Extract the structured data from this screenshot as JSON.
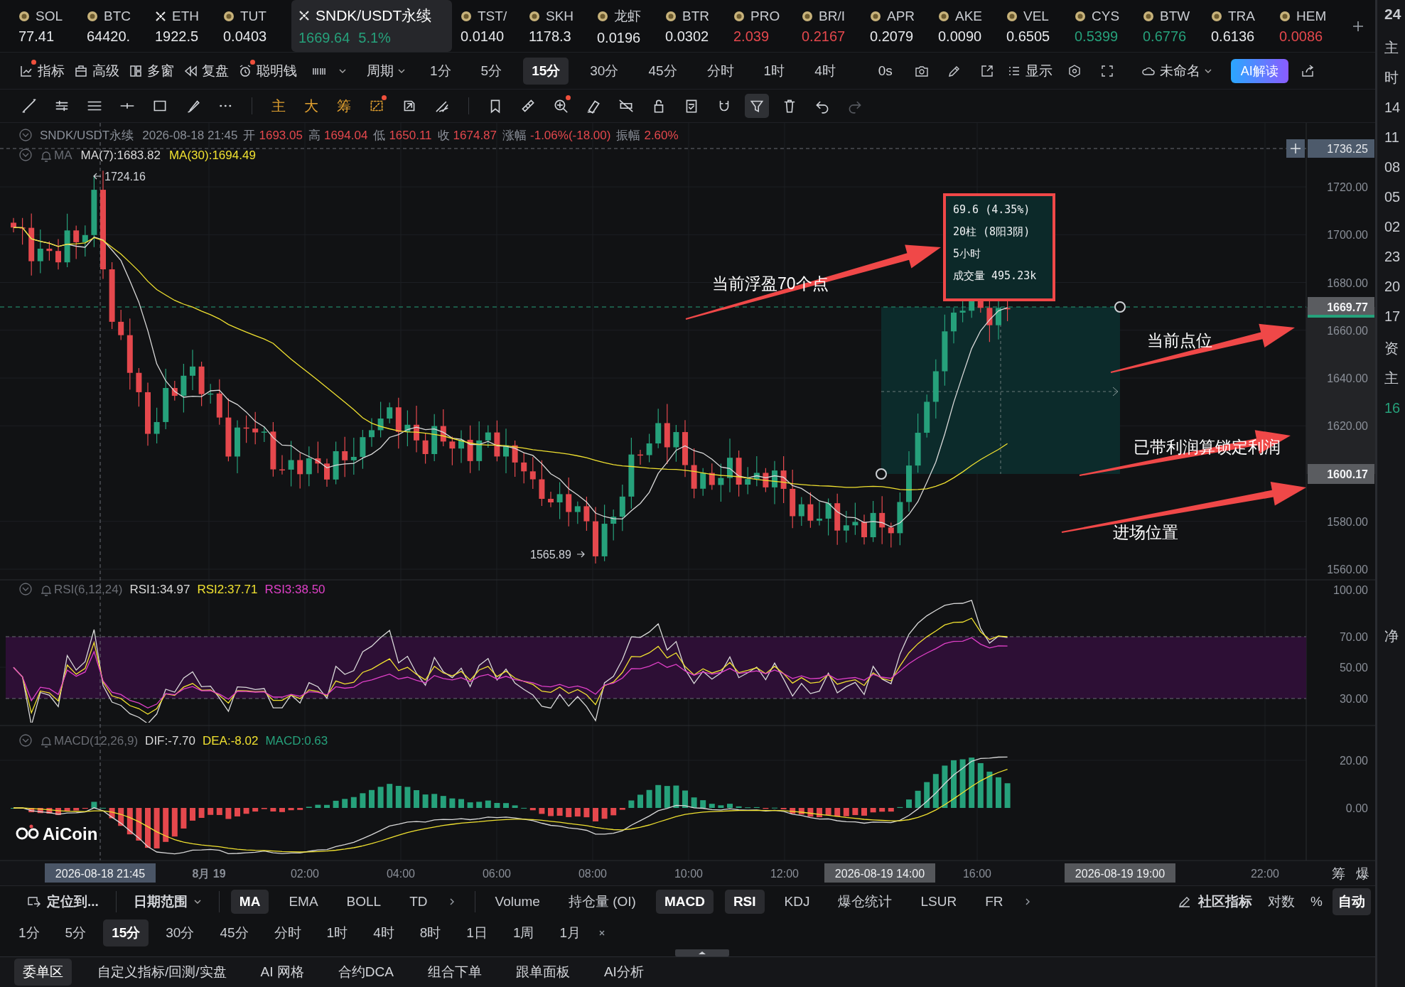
{
  "tickers": [
    {
      "name": "SOL",
      "price": "77.41",
      "kind": "coin",
      "color": "#e6e8eb",
      "selected": false
    },
    {
      "name": "BTC",
      "price": "64420.",
      "kind": "coin",
      "color": "#e6e8eb",
      "selected": false
    },
    {
      "name": "ETH",
      "price": "1922.5",
      "kind": "cross",
      "color": "#e6e8eb",
      "selected": false
    },
    {
      "name": "TUT",
      "price": "0.0403",
      "kind": "coin",
      "color": "#e6e8eb",
      "selected": false
    },
    {
      "name": "SNDK/USDT永续",
      "price": "1669.64",
      "pct": "5.1%",
      "kind": "cross",
      "color": "#26a17b",
      "selected": true
    },
    {
      "name": "TST/",
      "price": "0.0140",
      "kind": "coin",
      "color": "#e6e8eb",
      "selected": false
    },
    {
      "name": "SKH",
      "price": "1178.3",
      "kind": "coin",
      "color": "#e6e8eb",
      "selected": false
    },
    {
      "name": "龙虾",
      "price": "0.0196",
      "kind": "coin",
      "color": "#e6e8eb",
      "selected": false
    },
    {
      "name": "BTR",
      "price": "0.0302",
      "kind": "coin",
      "color": "#e6e8eb",
      "selected": false
    },
    {
      "name": "PRO",
      "price": "2.039",
      "kind": "coin",
      "color": "#e5484d",
      "selected": false
    },
    {
      "name": "BR/I",
      "price": "0.2167",
      "kind": "coin",
      "color": "#e5484d",
      "selected": false
    },
    {
      "name": "APR",
      "price": "0.2079",
      "kind": "coin",
      "color": "#e6e8eb",
      "selected": false
    },
    {
      "name": "AKE",
      "price": "0.0090",
      "kind": "coin",
      "color": "#e6e8eb",
      "selected": false
    },
    {
      "name": "VEL",
      "price": "0.6505",
      "kind": "coin",
      "color": "#e6e8eb",
      "selected": false
    },
    {
      "name": "CYS",
      "price": "0.5399",
      "kind": "coin",
      "color": "#26a17b",
      "selected": false
    },
    {
      "name": "BTW",
      "price": "0.6776",
      "kind": "coin",
      "color": "#26a17b",
      "selected": false
    },
    {
      "name": "TRA",
      "price": "0.6136",
      "kind": "coin",
      "color": "#e6e8eb",
      "selected": false
    },
    {
      "name": "HEM",
      "price": "0.0086",
      "kind": "coin",
      "color": "#e5484d",
      "selected": false
    }
  ],
  "toolbar": {
    "tools": [
      {
        "label": "指标",
        "kind": "chart",
        "dot": true
      },
      {
        "label": "高级",
        "kind": "case",
        "dot": false
      },
      {
        "label": "多窗",
        "kind": "grid",
        "dot": false
      },
      {
        "label": "复盘",
        "kind": "rewind",
        "dot": false
      },
      {
        "label": "聪明钱",
        "kind": "alarm",
        "dot": true
      }
    ],
    "period_label": "周期",
    "periods": [
      {
        "label": "1分",
        "selected": false
      },
      {
        "label": "5分",
        "selected": false
      },
      {
        "label": "15分",
        "selected": true
      },
      {
        "label": "30分",
        "selected": false
      },
      {
        "label": "45分",
        "selected": false
      },
      {
        "label": "分时",
        "selected": false
      },
      {
        "label": "1时",
        "selected": false
      },
      {
        "label": "4时",
        "selected": false
      }
    ],
    "timer": "0s",
    "display_label": "显示",
    "layout_name": "未命名",
    "ai_button": "AI解读"
  },
  "drawing_tools": [
    [
      {
        "kind": "trend",
        "selected": false,
        "dot": false,
        "disabled": false
      },
      {
        "kind": "parallel",
        "selected": false,
        "dot": false,
        "disabled": false
      },
      {
        "kind": "channel",
        "selected": false,
        "dot": false,
        "disabled": false
      },
      {
        "kind": "hline",
        "selected": false,
        "dot": false,
        "disabled": false
      },
      {
        "kind": "rect",
        "selected": false,
        "dot": false,
        "disabled": false
      },
      {
        "kind": "brush",
        "selected": false,
        "dot": false,
        "disabled": false
      },
      {
        "kind": "more",
        "selected": false,
        "dot": false,
        "disabled": false
      }
    ],
    [
      {
        "kind": "text",
        "label": "主",
        "selected": false,
        "dot": false,
        "disabled": false
      },
      {
        "kind": "text",
        "label": "大",
        "selected": false,
        "dot": false,
        "disabled": false
      },
      {
        "kind": "text",
        "label": "筹",
        "selected": false,
        "dot": false,
        "disabled": false
      },
      {
        "kind": "pattern",
        "selected": false,
        "dot": true,
        "disabled": false
      },
      {
        "kind": "rotate",
        "selected": false,
        "dot": false,
        "disabled": false
      },
      {
        "kind": "fork",
        "selected": false,
        "dot": false,
        "disabled": false
      }
    ],
    [
      {
        "kind": "bookmark",
        "selected": false,
        "dot": false,
        "disabled": false
      },
      {
        "kind": "ruler",
        "selected": false,
        "dot": false,
        "disabled": false
      },
      {
        "kind": "zoom",
        "selected": false,
        "dot": true,
        "disabled": false
      },
      {
        "kind": "eraser",
        "selected": false,
        "dot": false,
        "disabled": false
      },
      {
        "kind": "hide",
        "selected": false,
        "dot": false,
        "disabled": false
      },
      {
        "kind": "lock",
        "selected": false,
        "dot": false,
        "disabled": false
      },
      {
        "kind": "note",
        "selected": false,
        "dot": false,
        "disabled": false
      },
      {
        "kind": "magnet",
        "selected": false,
        "dot": false,
        "disabled": false
      },
      {
        "kind": "filter",
        "selected": true,
        "dot": false,
        "disabled": false
      },
      {
        "kind": "trash",
        "selected": false,
        "dot": false,
        "disabled": false
      },
      {
        "kind": "undo",
        "selected": false,
        "dot": false,
        "disabled": false
      },
      {
        "kind": "redo",
        "selected": false,
        "dot": false,
        "disabled": true
      }
    ]
  ],
  "chart": {
    "header": {
      "symbol": "SNDK/USDT永续",
      "time": "2026-08-18 21:45",
      "fields": [
        {
          "label": "开",
          "value": "1693.05"
        },
        {
          "label": "高",
          "value": "1694.04"
        },
        {
          "label": "低",
          "value": "1650.11"
        },
        {
          "label": "收",
          "value": "1674.87"
        },
        {
          "label": "涨幅",
          "value": "-1.06%(-18.00)"
        },
        {
          "label": "振幅",
          "value": "2.60%"
        }
      ]
    },
    "ma": {
      "label": "MA",
      "values": [
        {
          "text": "MA(7):1683.82",
          "color": "#d9d9d9"
        },
        {
          "text": "MA(30):1694.49",
          "color": "#f0e130"
        }
      ]
    },
    "high_marker": "1724.16",
    "low_marker": "1565.89",
    "price_ticks": [
      "1720.00",
      "1700.00",
      "1680.00",
      "1660.00",
      "1640.00",
      "1620.00",
      "1580.00",
      "1560.00"
    ],
    "price_tags": [
      {
        "text": "1736.25",
        "kind": "cursor"
      },
      {
        "text": "1669.77",
        "kind": "last"
      },
      {
        "text": "1600.17",
        "kind": "range"
      }
    ],
    "measure": [
      "69.6 (4.35%)",
      "20柱 (8阳3阴)",
      "5小时",
      "成交量 495.23k"
    ],
    "annotations": [
      {
        "text": "当前浮盈70个点"
      },
      {
        "text": "当前点位"
      },
      {
        "text": "已带利润算锁定利润"
      },
      {
        "text": "进场位置"
      }
    ],
    "rsi": {
      "label": "RSI(6,12,24)",
      "values": [
        {
          "text": "RSI1:34.97",
          "color": "#d9d9d9"
        },
        {
          "text": "RSI2:37.71",
          "color": "#f0e130"
        },
        {
          "text": "RSI3:38.50",
          "color": "#e040c8"
        }
      ],
      "ticks": [
        "100.00",
        "70.00",
        "50.00",
        "30.00"
      ]
    },
    "macd": {
      "label": "MACD(12,26,9)",
      "values": [
        {
          "text": "DIF:-7.70",
          "color": "#d9d9d9"
        },
        {
          "text": "DEA:-8.02",
          "color": "#f0e130"
        },
        {
          "text": "MACD:0.63",
          "color": "#26a17b"
        }
      ],
      "ticks": [
        "20.00",
        "0.00"
      ]
    },
    "logo": "AiCoin",
    "time_ticks": [
      "8月 19",
      "02:00",
      "04:00",
      "06:00",
      "08:00",
      "10:00",
      "12:00",
      "16:00",
      "22:00"
    ],
    "time_tags": [
      "2026-08-18 21:45",
      "2026-08-19 14:00",
      "2026-08-19 19:00"
    ],
    "axis_buttons": [
      "筹",
      "爆"
    ]
  },
  "indicator_bar": {
    "locate": "定位到...",
    "date_range": "日期范围",
    "main_indicators": [
      {
        "label": "MA",
        "selected": true
      },
      {
        "label": "EMA",
        "selected": false
      },
      {
        "label": "BOLL",
        "selected": false
      },
      {
        "label": "TD",
        "selected": false
      }
    ],
    "sub_indicators": [
      {
        "label": "Volume",
        "selected": false
      },
      {
        "label": "持仓量 (OI)",
        "selected": false
      },
      {
        "label": "MACD",
        "selected": true
      },
      {
        "label": "RSI",
        "selected": true
      },
      {
        "label": "KDJ",
        "selected": false
      },
      {
        "label": "爆仓统计",
        "selected": false
      },
      {
        "label": "LSUR",
        "selected": false
      },
      {
        "label": "FR",
        "selected": false
      }
    ],
    "community": "社区指标",
    "scale_options": [
      {
        "label": "对数",
        "selected": false
      },
      {
        "label": "%",
        "selected": false
      },
      {
        "label": "自动",
        "selected": true
      }
    ]
  },
  "period_bar": [
    {
      "label": "1分",
      "selected": false
    },
    {
      "label": "5分",
      "selected": false
    },
    {
      "label": "15分",
      "selected": true
    },
    {
      "label": "30分",
      "selected": false
    },
    {
      "label": "45分",
      "selected": false
    },
    {
      "label": "分时",
      "selected": false
    },
    {
      "label": "1时",
      "selected": false
    },
    {
      "label": "4时",
      "selected": false
    },
    {
      "label": "8时",
      "selected": false
    },
    {
      "label": "1日",
      "selected": false
    },
    {
      "label": "1周",
      "selected": false
    },
    {
      "label": "1月",
      "selected": false
    }
  ],
  "bottom_tabs": [
    {
      "label": "委单区",
      "selected": true
    },
    {
      "label": "自定义指标/回测/实盘",
      "selected": false
    },
    {
      "label": "AI 网格",
      "selected": false
    },
    {
      "label": "合约DCA",
      "selected": false
    },
    {
      "label": "组合下单",
      "selected": false
    },
    {
      "label": "跟单面板",
      "selected": false
    },
    {
      "label": "AI分析",
      "selected": false
    }
  ],
  "side_panel": {
    "header": "24",
    "sections": [
      [
        {
          "text": "主",
          "accent": false
        },
        {
          "text": "时",
          "accent": false
        },
        {
          "text": "14",
          "accent": false
        },
        {
          "text": "11",
          "accent": false
        },
        {
          "text": "08",
          "accent": false
        },
        {
          "text": "05",
          "accent": false
        },
        {
          "text": "02",
          "accent": false
        },
        {
          "text": "23",
          "accent": false
        },
        {
          "text": "20",
          "accent": false
        },
        {
          "text": "17",
          "accent": false
        }
      ],
      [
        {
          "text": "资",
          "accent": false
        },
        {
          "text": "主",
          "accent": false
        },
        {
          "text": "16",
          "accent": true
        }
      ],
      [
        {
          "text": "净",
          "accent": false
        }
      ]
    ]
  }
}
